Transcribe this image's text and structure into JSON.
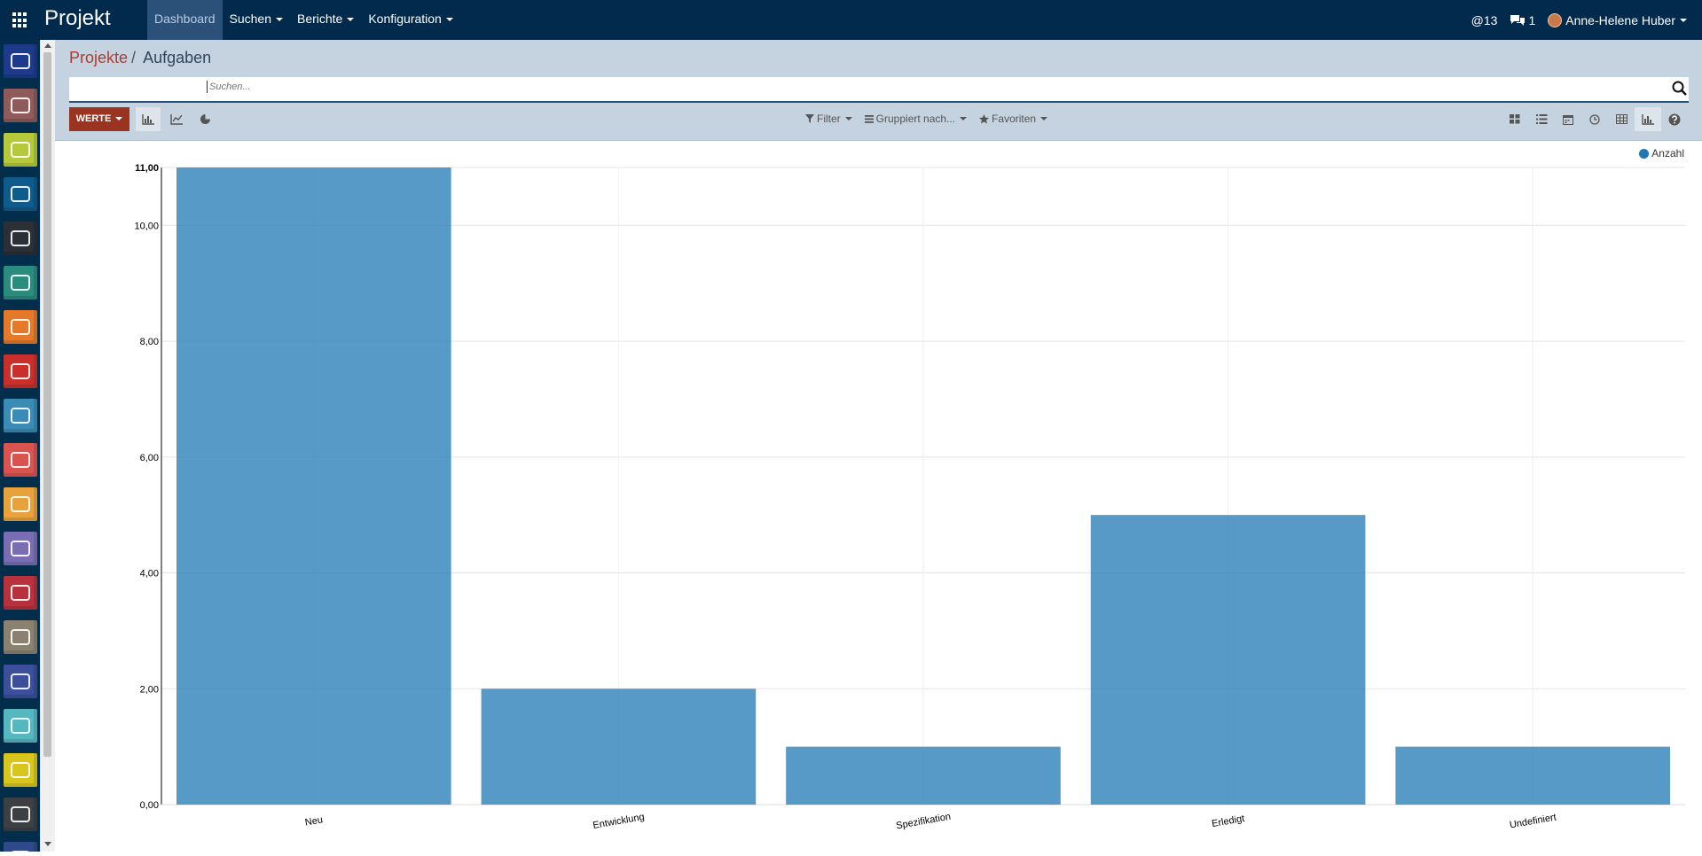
{
  "app": {
    "title": "Projekt",
    "menu": [
      {
        "label": "Dashboard",
        "active": true,
        "dropdown": false
      },
      {
        "label": "Suchen",
        "active": false,
        "dropdown": true
      },
      {
        "label": "Berichte",
        "active": false,
        "dropdown": true
      },
      {
        "label": "Konfiguration",
        "active": false,
        "dropdown": true
      }
    ],
    "mentions_count": "@13",
    "messages_count": "1",
    "user_name": "Anne-Helene Huber"
  },
  "sidebar": {
    "apps": [
      {
        "name": "ezb-logo-icon",
        "color": "#1d3b8a"
      },
      {
        "name": "chat-bubble-icon",
        "color": "#8e5a5a"
      },
      {
        "name": "calendar-icon",
        "color": "#b6c93a"
      },
      {
        "name": "database-icon",
        "color": "#0f5b8c"
      },
      {
        "name": "notes-edit-icon",
        "color": "#2b2f36"
      },
      {
        "name": "contact-icon",
        "color": "#2a8b7f"
      },
      {
        "name": "trend-chart-icon",
        "color": "#e5792a"
      },
      {
        "name": "crm-icon",
        "color": "#c9302c"
      },
      {
        "name": "credit-card-icon",
        "color": "#3a8bb5"
      },
      {
        "name": "warehouse-icon",
        "color": "#d9534f"
      },
      {
        "name": "document-icon",
        "color": "#e7a23c"
      },
      {
        "name": "puzzle-icon",
        "color": "#7a6db3"
      },
      {
        "name": "clock-icon",
        "color": "#b8323d"
      },
      {
        "name": "paper-plane-icon",
        "color": "#8b8170"
      },
      {
        "name": "group-icon",
        "color": "#3b4f9b"
      },
      {
        "name": "user-check-icon",
        "color": "#55b8c0"
      },
      {
        "name": "sun-icon",
        "color": "#d9c61d"
      },
      {
        "name": "dollar-icon",
        "color": "#3d4042"
      },
      {
        "name": "extra-app-icon",
        "color": "#2e4a8a"
      }
    ]
  },
  "breadcrumb": {
    "parent": "Projekte",
    "separator": "/",
    "current": "Aufgaben"
  },
  "search": {
    "placeholder": "Suchen..."
  },
  "toolbar": {
    "werte_label": "WERTE",
    "filter_label": "Filter",
    "group_label": "Gruppiert nach...",
    "favorites_label": "Favoriten"
  },
  "chart_data": {
    "type": "bar",
    "categories": [
      "Neu",
      "Entwicklung",
      "Spezifikation",
      "Erledigt",
      "Undefiniert"
    ],
    "series": [
      {
        "name": "Anzahl",
        "values": [
          11,
          2,
          1,
          5,
          1
        ],
        "color": "#1f77b4"
      }
    ],
    "ylim": [
      0,
      11
    ],
    "yticks": [
      "0,00",
      "2,00",
      "4,00",
      "6,00",
      "8,00",
      "10,00",
      "11,00"
    ],
    "ytick_values": [
      0,
      2,
      4,
      6,
      8,
      10,
      11
    ],
    "legend": "top-right",
    "grid": true
  }
}
